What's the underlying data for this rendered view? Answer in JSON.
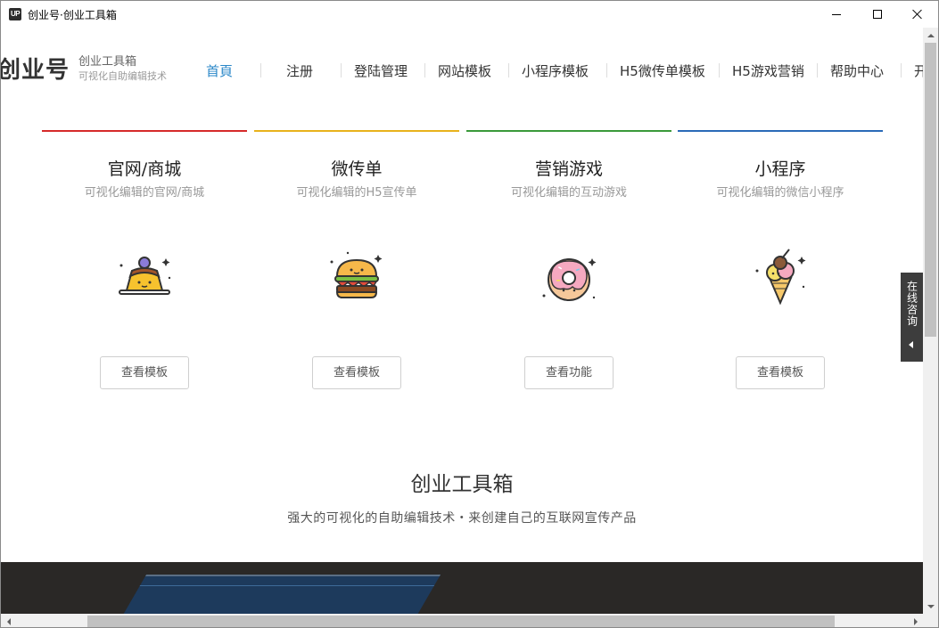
{
  "window": {
    "icon_label": "UP",
    "title": "创业号·创业工具箱"
  },
  "header": {
    "logo_text": "创业号",
    "brand_name": "创业工具箱",
    "slogan": "可视化自助编辑技术",
    "nav": [
      "首頁",
      "注册",
      "登陆管理",
      "网站模板",
      "小程序模板",
      "H5微传单模板",
      "H5游戏营销",
      "帮助中心",
      "开"
    ],
    "active_index": 0
  },
  "cards": [
    {
      "title": "官网/商城",
      "subtitle": "可视化编辑的官网/商城",
      "button": "查看模板",
      "accent": "#d62a2a",
      "icon": "pudding-icon"
    },
    {
      "title": "微传单",
      "subtitle": "可视化编辑的H5宣传单",
      "button": "查看模板",
      "accent": "#e8b21c",
      "icon": "burger-icon"
    },
    {
      "title": "营销游戏",
      "subtitle": "可视化编辑的互动游戏",
      "button": "查看功能",
      "accent": "#3a9a3a",
      "icon": "donut-icon"
    },
    {
      "title": "小程序",
      "subtitle": "可视化编辑的微信小程序",
      "button": "查看模板",
      "accent": "#2a6ab8",
      "icon": "ice-cream-icon"
    }
  ],
  "section": {
    "title": "创业工具箱",
    "subtitle": "强大的可视化的自助编辑技术・来创建自己的互联网宣传产品"
  },
  "consult": {
    "label": "在线咨询"
  },
  "colors": {
    "nav_active": "#2a87c8",
    "banner": "#2a2826"
  }
}
